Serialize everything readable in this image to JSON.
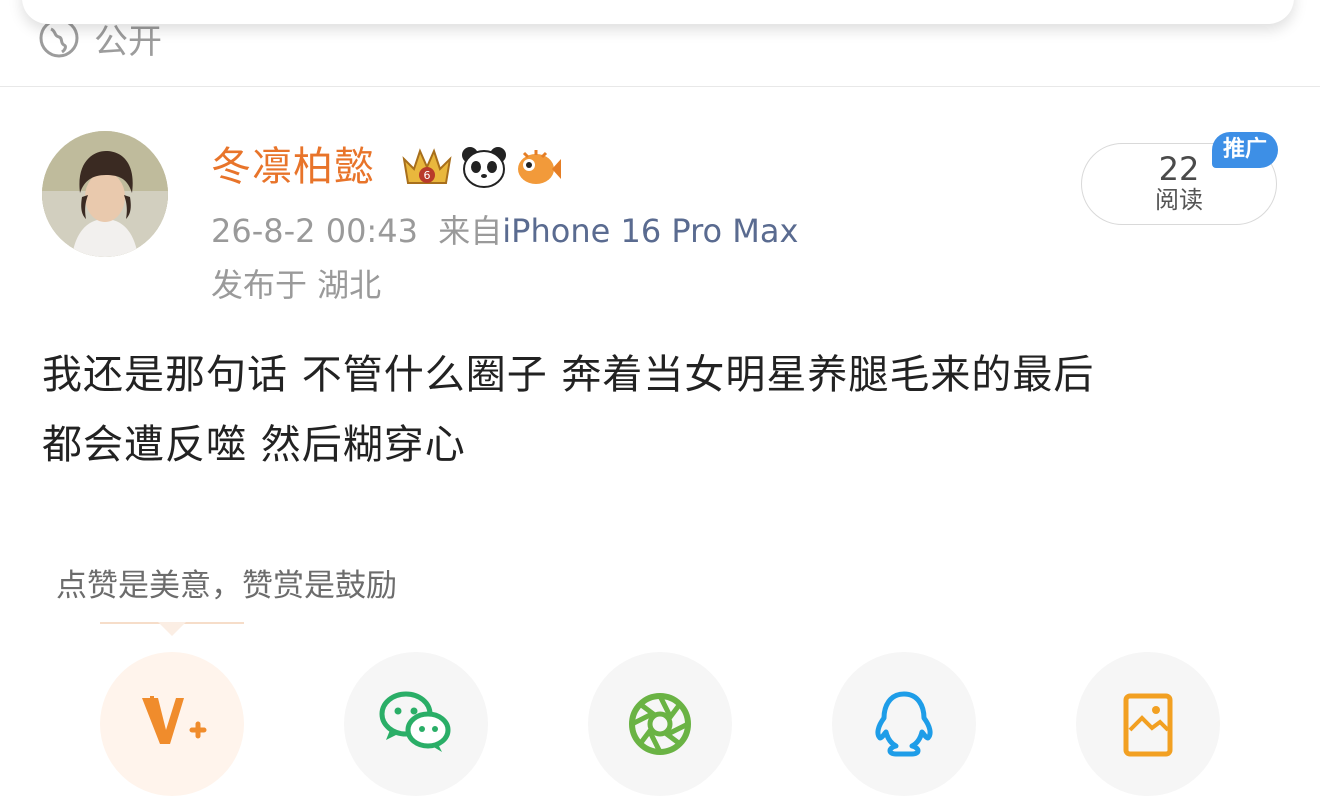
{
  "top_card": {
    "visibility_label": "公开",
    "visibility_icon": "globe-icon"
  },
  "post": {
    "author": {
      "name": "冬凛柏懿",
      "avatar": "avatar",
      "badges": [
        "crown-vip-icon",
        "panda-icon",
        "pufferfish-icon"
      ]
    },
    "timestamp": "26-8-2 00:43",
    "source_prefix": "来自",
    "device": "iPhone 16 Pro Max",
    "location": "发布于 湖北",
    "reads": {
      "count": "22",
      "label": "阅读"
    },
    "promo_tag": "推广",
    "content_lines": [
      "我还是那句话 不管什么圈子 奔着当女明星养腿毛来的最后",
      "都会遭反噬 然后糊穿心"
    ]
  },
  "reward": {
    "tip": "点赞是美意，赞赏是鼓励"
  },
  "share_targets": [
    "v-plus-icon",
    "wechat-icon",
    "moments-icon",
    "qq-icon",
    "image-share-icon"
  ],
  "colors": {
    "username": "#e8742a",
    "device": "#5a6b90",
    "promo": "#3d8fe6",
    "wechat": "#2aae67",
    "moments": "#6ab344",
    "qq": "#1e9de8",
    "v_plus": "#f08c2c",
    "image_share": "#f2a022"
  }
}
